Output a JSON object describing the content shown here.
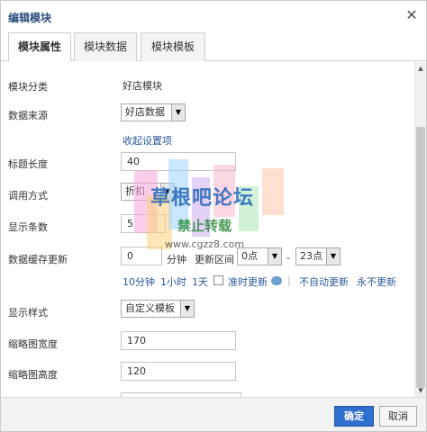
{
  "dialog": {
    "title": "编辑模块",
    "close_glyph": "✕"
  },
  "tabs": [
    {
      "label": "模块属性",
      "active": true
    },
    {
      "label": "模块数据",
      "active": false
    },
    {
      "label": "模块模板",
      "active": false
    }
  ],
  "form": {
    "category_label": "模块分类",
    "category_value": "好店模块",
    "source_label": "数据来源",
    "source_value": "好店数据",
    "collapse_link": "收起设置项",
    "title_length_label": "标题长度",
    "title_length_value": "40",
    "call_method_label": "调用方式",
    "call_method_value": "折扣",
    "display_count_label": "显示条数",
    "display_count_value": "5",
    "cache_label": "数据缓存更新",
    "cache_value": "0",
    "cache_unit": "分钟",
    "update_range_label": "更新区间",
    "range_start": "0点",
    "range_sep": "-",
    "range_end": "23点",
    "quick_10min": "10分钟",
    "quick_1h": "1小时",
    "quick_1d": "1天",
    "realtime_label": "准时更新",
    "no_auto": "不自动更新",
    "never": "永不更新",
    "style_label": "显示样式",
    "style_value": "自定义模板",
    "thumb_width_label": "缩略图宽度",
    "thumb_width_value": "170",
    "thumb_height_label": "缩略图高度",
    "thumb_height_value": "120"
  },
  "footer": {
    "confirm": "确定",
    "cancel": "取消"
  },
  "watermark": {
    "line1": "草根吧论坛",
    "line2": "禁止转载",
    "url": "www.cgzz8.com"
  },
  "colors": {
    "accent": "#2f6fcf",
    "link": "#2a5a9a",
    "title": "#2b4f7d"
  }
}
